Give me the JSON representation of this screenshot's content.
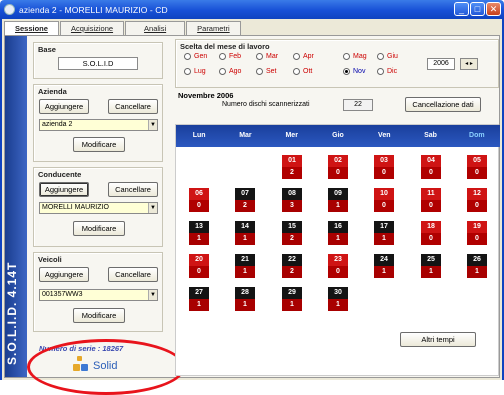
{
  "window": {
    "title": "azienda 2 - MORELLI MAURIZIO - CD"
  },
  "tabs": [
    "Sessione",
    "Acquisizione",
    "Analisi",
    "Parametri"
  ],
  "sidebar_brand": "S.O.L.I.D. 4.14T",
  "base": {
    "title": "Base",
    "value": "S.O.L.I.D"
  },
  "azienda": {
    "title": "Azienda",
    "add": "Aggiungere",
    "delete": "Cancellare",
    "selected": "azienda 2",
    "modify": "Modificare"
  },
  "conducente": {
    "title": "Conducente",
    "add": "Aggiungere",
    "delete": "Cancellare",
    "selected": "MORELLI MAURIZIO",
    "modify": "Modificare"
  },
  "veicoli": {
    "title": "Veicoli",
    "add": "Aggiungere",
    "delete": "Cancellare",
    "selected": "001357WW3",
    "modify": "Modificare"
  },
  "serial": "Numero di serie : 18267",
  "logo_text": "Solid",
  "month_select": {
    "title": "Scelta del mese di lavoro",
    "months": [
      "Gen",
      "Feb",
      "Mar",
      "Apr",
      "Mag",
      "Giu",
      "Lug",
      "Ago",
      "Set",
      "Ott",
      "Nov",
      "Dic"
    ],
    "selected": "Nov",
    "year": "2006"
  },
  "calendar": {
    "month_label": "Novembre 2006",
    "scan_label": "Numero dischi scannerizzati",
    "scan_count": "22",
    "delete_button": "Cancellazione dati",
    "weekdays": [
      "Lun",
      "Mar",
      "Mer",
      "Gio",
      "Ven",
      "Sab",
      "Dom"
    ],
    "first_weekday_index": 2,
    "days": [
      {
        "day": "01",
        "count": "2",
        "style": "red"
      },
      {
        "day": "02",
        "count": "0",
        "style": "red"
      },
      {
        "day": "03",
        "count": "0",
        "style": "red"
      },
      {
        "day": "04",
        "count": "0",
        "style": "red"
      },
      {
        "day": "05",
        "count": "0",
        "style": "red"
      },
      {
        "day": "06",
        "count": "0",
        "style": "red"
      },
      {
        "day": "07",
        "count": "2",
        "style": "black"
      },
      {
        "day": "08",
        "count": "3",
        "style": "black"
      },
      {
        "day": "09",
        "count": "1",
        "style": "black"
      },
      {
        "day": "10",
        "count": "0",
        "style": "red"
      },
      {
        "day": "11",
        "count": "0",
        "style": "red"
      },
      {
        "day": "12",
        "count": "0",
        "style": "red"
      },
      {
        "day": "13",
        "count": "1",
        "style": "black"
      },
      {
        "day": "14",
        "count": "1",
        "style": "black"
      },
      {
        "day": "15",
        "count": "2",
        "style": "black"
      },
      {
        "day": "16",
        "count": "1",
        "style": "black"
      },
      {
        "day": "17",
        "count": "1",
        "style": "black"
      },
      {
        "day": "18",
        "count": "0",
        "style": "red"
      },
      {
        "day": "19",
        "count": "0",
        "style": "red"
      },
      {
        "day": "20",
        "count": "0",
        "style": "red"
      },
      {
        "day": "21",
        "count": "1",
        "style": "black"
      },
      {
        "day": "22",
        "count": "2",
        "style": "black"
      },
      {
        "day": "23",
        "count": "0",
        "style": "red"
      },
      {
        "day": "24",
        "count": "1",
        "style": "black"
      },
      {
        "day": "25",
        "count": "1",
        "style": "black"
      },
      {
        "day": "26",
        "count": "1",
        "style": "black"
      },
      {
        "day": "27",
        "count": "1",
        "style": "black"
      },
      {
        "day": "28",
        "count": "1",
        "style": "black"
      },
      {
        "day": "29",
        "count": "1",
        "style": "black"
      },
      {
        "day": "30",
        "count": "1",
        "style": "black"
      }
    ],
    "more_button": "Altri tempi"
  }
}
